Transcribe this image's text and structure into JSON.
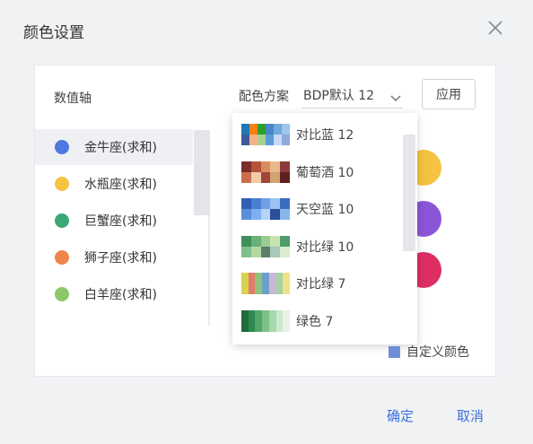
{
  "dialog": {
    "title": "颜色设置",
    "close_icon": "close-icon"
  },
  "toolbar": {
    "axis_label": "数值轴",
    "scheme_label": "配色方案",
    "scheme_value": "BDP默认 12",
    "apply_label": "应用"
  },
  "series": [
    {
      "label": "金牛座(求和)",
      "color": "#4e78e0"
    },
    {
      "label": "水瓶座(求和)",
      "color": "#f5c342"
    },
    {
      "label": "巨蟹座(求和)",
      "color": "#3aa875"
    },
    {
      "label": "狮子座(求和)",
      "color": "#f0854a"
    },
    {
      "label": "白羊座(求和)",
      "color": "#8cc768"
    }
  ],
  "preview_colors": [
    "#f5c342",
    "#8b55d8",
    "#dd2e64"
  ],
  "palettes": [
    {
      "label": "对比蓝 12",
      "colors": [
        "#1f77b4",
        "#ff7f0e",
        "#2ca02c",
        "#4a86c9",
        "#6fa8dc",
        "#9fc5e8",
        "#3d5a99",
        "#f4b183",
        "#a9d18e",
        "#5b9bd5",
        "#c9daf8",
        "#8eaadb"
      ]
    },
    {
      "label": "葡萄酒 10",
      "colors": [
        "#7b2c2c",
        "#b5523b",
        "#d98c5f",
        "#e8b98a",
        "#8c3a3a",
        "#c96f4f",
        "#f0cda8",
        "#a0453a",
        "#d4a373",
        "#5e2020"
      ]
    },
    {
      "label": "天空蓝 10",
      "colors": [
        "#2f5fb3",
        "#4a7fd1",
        "#6f9fe6",
        "#9cc1f2",
        "#3b6dbf",
        "#5a8ed8",
        "#7fb0ee",
        "#b5d3f7",
        "#2a4f96",
        "#88b6ec"
      ]
    },
    {
      "label": "对比绿 10",
      "colors": [
        "#3f8f5b",
        "#6ab07a",
        "#9acb8f",
        "#c8e2b0",
        "#4f9c6b",
        "#7fbf8a",
        "#b3d9a0",
        "#5a7f6a",
        "#a8c8b8",
        "#d9ecd0"
      ]
    },
    {
      "label": "对比绿 7",
      "colors": [
        "#d8d24f",
        "#e37b6c",
        "#8fc27a",
        "#6aa0c9",
        "#c9b8d8",
        "#a6d3a0",
        "#f1e28a"
      ]
    },
    {
      "label": "绿色 7",
      "colors": [
        "#1f6b3a",
        "#2e8a4e",
        "#4fa868",
        "#7cc18a",
        "#a8d8ae",
        "#cde8cf",
        "#e6f3e6"
      ]
    }
  ],
  "custom_color_label": "自定义颜色",
  "footer": {
    "ok_label": "确定",
    "cancel_label": "取消"
  }
}
